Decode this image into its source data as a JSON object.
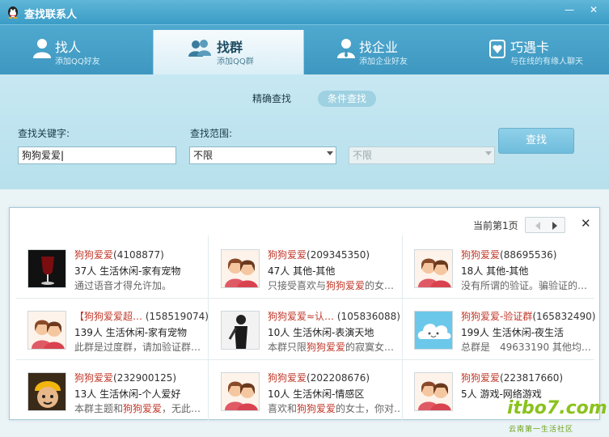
{
  "window": {
    "title": "查找联系人",
    "minimize": "—",
    "close": "✕"
  },
  "tabs": [
    {
      "label": "找人",
      "sub": "添加QQ好友",
      "icon": "person-icon"
    },
    {
      "label": "找群",
      "sub": "添加QQ群",
      "icon": "group-icon"
    },
    {
      "label": "找企业",
      "sub": "添加企业好友",
      "icon": "enterprise-icon"
    },
    {
      "label": "巧遇卡",
      "sub": "与在线的有缘人聊天",
      "icon": "card-icon"
    }
  ],
  "search": {
    "mode_exact": "精确查找",
    "mode_condition": "条件查找",
    "keyword_label": "查找关键字:",
    "keyword_value": "狗狗爱爱",
    "range_label": "查找范围:",
    "range_value": "不限",
    "range2_value": "不限",
    "button": "查找"
  },
  "results": {
    "page_text": "当前第1页",
    "close": "✕",
    "items": [
      {
        "name_hl": "狗狗爱爱",
        "name_rest": "(4108877)",
        "meta": "37人 生活休闲-家有宠物",
        "desc_pre": "通过语音才得允许加。",
        "desc_hl": "",
        "desc_post": ""
      },
      {
        "name_hl": "狗狗爱爱",
        "name_rest": "(209345350)",
        "meta": "47人 其他-其他",
        "desc_pre": "只接受喜欢与",
        "desc_hl": "狗狗爱爱",
        "desc_post": "的女…"
      },
      {
        "name_hl": "狗狗爱爱",
        "name_rest": "(88695536)",
        "meta": "18人 其他-其他",
        "desc_pre": "没有所谓的验证。骗验证的…",
        "desc_hl": "",
        "desc_post": ""
      },
      {
        "name_hl": "【狗狗爱爱超…",
        "name_rest": " (158519074)",
        "meta": "139人 生活休闲-家有宠物",
        "desc_pre": "此群是过度群，请加验证群…",
        "desc_hl": "",
        "desc_post": ""
      },
      {
        "name_hl": "狗狗爱爱≈认…",
        "name_rest": " (105836088)",
        "meta": "10人 生活休闲-表演天地",
        "desc_pre": "本群只限",
        "desc_hl": "狗狗爱爱",
        "desc_post": "的寂寞女…"
      },
      {
        "name_hl": "狗狗爱爱-验证群",
        "name_rest": "(165832490)",
        "meta": "199人 生活休闲-夜生活",
        "desc_pre": "总群是　49633190 其他均…",
        "desc_hl": "",
        "desc_post": ""
      },
      {
        "name_hl": "狗狗爱爱",
        "name_rest": "(232900125)",
        "meta": "13人 生活休闲-个人爱好",
        "desc_pre": "本群主题和",
        "desc_hl": "狗狗爱爱",
        "desc_post": "，无此…"
      },
      {
        "name_hl": "狗狗爱爱",
        "name_rest": "(202208676)",
        "meta": "10人 生活休闲-情感区",
        "desc_pre": "喜欢和",
        "desc_hl": "狗狗爱爱",
        "desc_post": "的女士，你对…"
      },
      {
        "name_hl": "狗狗爱爱",
        "name_rest": "(223817660)",
        "meta": "5人 游戏-网络游戏",
        "desc_pre": "",
        "desc_hl": "",
        "desc_post": ""
      }
    ]
  },
  "watermark": {
    "main": "itbo7.com",
    "sub": "云南第一生活社区"
  },
  "colors": {
    "accent": "#3e9dc6",
    "highlight": "#c0392b",
    "panel": "#c0e4ef"
  }
}
